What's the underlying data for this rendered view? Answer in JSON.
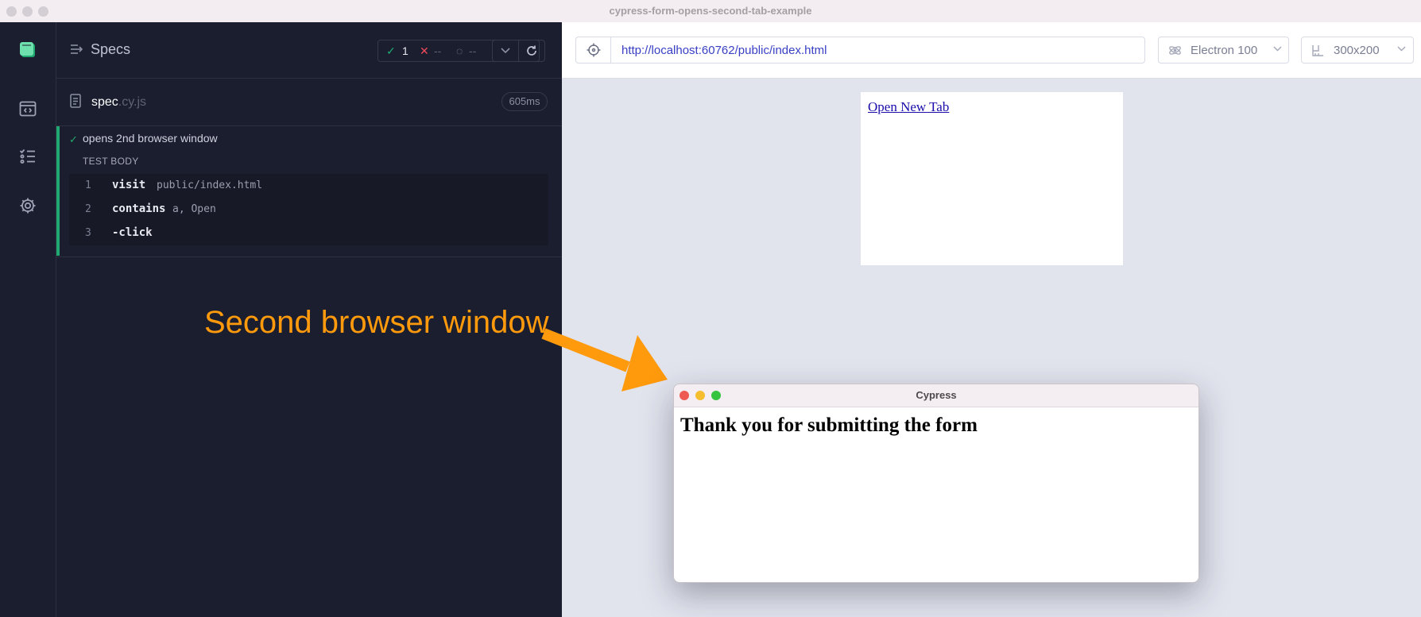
{
  "window": {
    "title": "cypress-form-opens-second-tab-example"
  },
  "reporter": {
    "specs_label": "Specs",
    "stats": {
      "passed": "1",
      "failed": "--",
      "pending": "--"
    },
    "spec": {
      "name": "spec",
      "ext": ".cy.js",
      "duration": "605ms"
    },
    "test": {
      "title": "opens 2nd browser window",
      "section": "TEST BODY",
      "commands": [
        {
          "num": "1",
          "name": "visit",
          "message": "public/index.html"
        },
        {
          "num": "2",
          "name": "contains",
          "message": "a, Open"
        },
        {
          "num": "3",
          "name": "-click",
          "message": ""
        }
      ]
    }
  },
  "annotation": {
    "text": "Second browser window",
    "color": "#ff9a0d"
  },
  "aut": {
    "url": "http://localhost:60762/public/index.html",
    "browser": "Electron 100",
    "viewport": "300x200",
    "page": {
      "link_text": "Open New Tab"
    }
  },
  "second_window": {
    "title": "Cypress",
    "heading": "Thank you for submitting the form"
  },
  "colors": {
    "pass": "#1fa971",
    "fail": "#ef4b5f",
    "accent": "#3940c4"
  }
}
